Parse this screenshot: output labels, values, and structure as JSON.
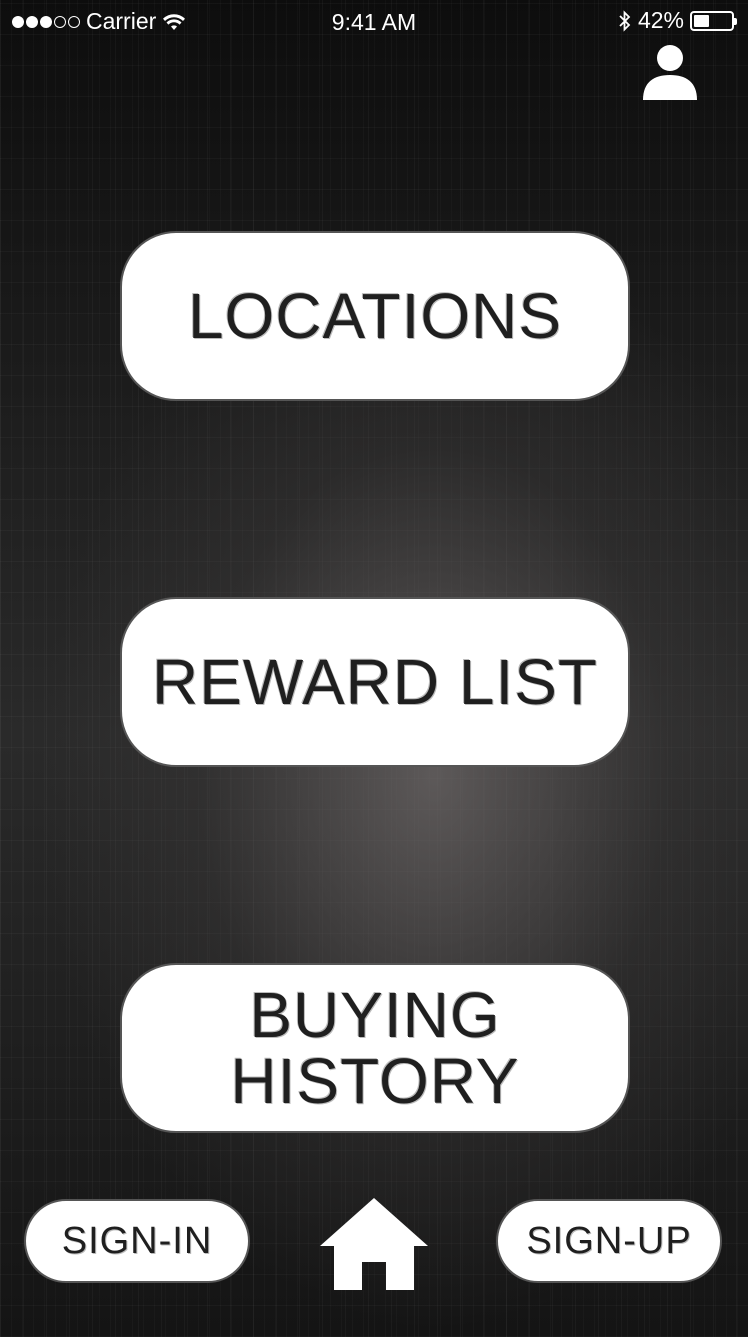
{
  "status_bar": {
    "carrier": "Carrier",
    "time": "9:41 AM",
    "battery": "42%",
    "battery_level": 0.42,
    "signal_bars_filled": 3,
    "signal_bars_total": 5
  },
  "header": {
    "profile_icon": "user-silhouette-icon"
  },
  "menu": {
    "locations_label": "LOCATIONS",
    "reward_list_label": "REWARD LIST",
    "buying_history_label": "BUYING\nHISTORY"
  },
  "footer": {
    "sign_in_label": "SIGN-IN",
    "sign_up_label": "SIGN-UP",
    "home_icon": "home-icon"
  },
  "colors": {
    "button_bg": "#ffffff",
    "text": "#1f1f1f",
    "background": "#1c1c1c"
  }
}
